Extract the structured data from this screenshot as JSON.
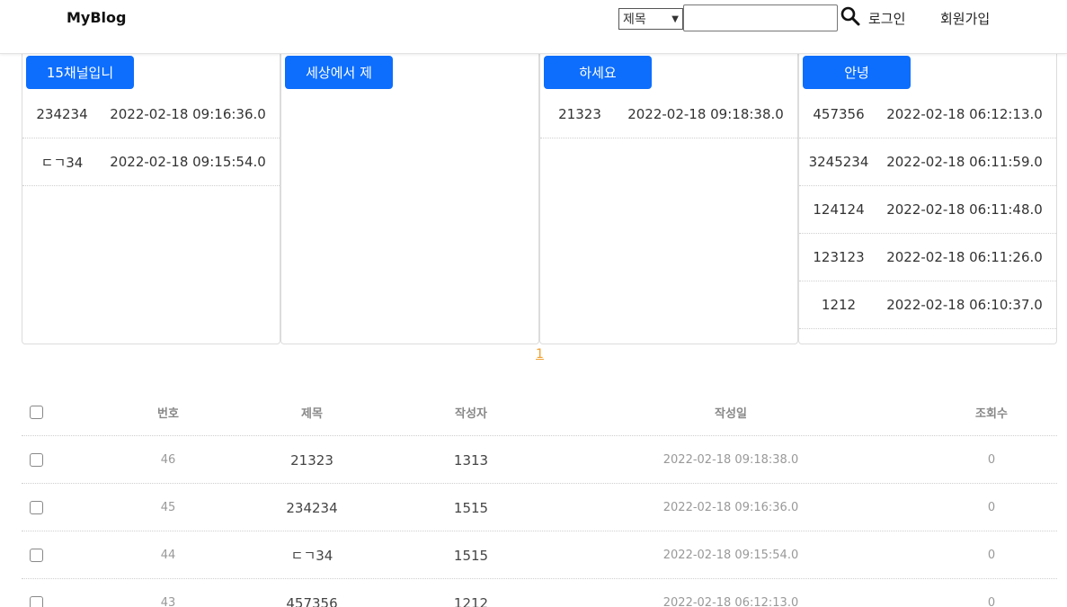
{
  "header": {
    "brand": "MyBlog",
    "search_field_selected": "제목",
    "search_query": "",
    "login_label": "로그인",
    "signup_label": "회원가입"
  },
  "channels": [
    {
      "name": "15채널입니",
      "posts": [
        {
          "title": "234234",
          "date": "2022-02-18 09:16:36.0"
        },
        {
          "title": "ㄷㄱ34",
          "date": "2022-02-18 09:15:54.0"
        }
      ]
    },
    {
      "name": "세상에서 제",
      "posts": []
    },
    {
      "name": "하세요",
      "posts": [
        {
          "title": "21323",
          "date": "2022-02-18 09:18:38.0"
        }
      ]
    },
    {
      "name": "안녕",
      "posts": [
        {
          "title": "457356",
          "date": "2022-02-18 06:12:13.0"
        },
        {
          "title": "3245234",
          "date": "2022-02-18 06:11:59.0"
        },
        {
          "title": "124124",
          "date": "2022-02-18 06:11:48.0"
        },
        {
          "title": "123123",
          "date": "2022-02-18 06:11:26.0"
        },
        {
          "title": "1212",
          "date": "2022-02-18 06:10:37.0"
        }
      ]
    }
  ],
  "pagination": {
    "current": "1"
  },
  "table": {
    "columns": {
      "no": "번호",
      "title": "제목",
      "author": "작성자",
      "date": "작성일",
      "views": "조회수"
    },
    "rows": [
      {
        "no": "46",
        "title": "21323",
        "author": "1313",
        "date": "2022-02-18 09:18:38.0",
        "views": "0"
      },
      {
        "no": "45",
        "title": "234234",
        "author": "1515",
        "date": "2022-02-18 09:16:36.0",
        "views": "0"
      },
      {
        "no": "44",
        "title": "ㄷㄱ34",
        "author": "1515",
        "date": "2022-02-18 09:15:54.0",
        "views": "0"
      },
      {
        "no": "43",
        "title": "457356",
        "author": "1212",
        "date": "2022-02-18 06:12:13.0",
        "views": "0"
      }
    ]
  },
  "colors": {
    "accent": "#0d6efd",
    "pager": "#f0a030"
  }
}
